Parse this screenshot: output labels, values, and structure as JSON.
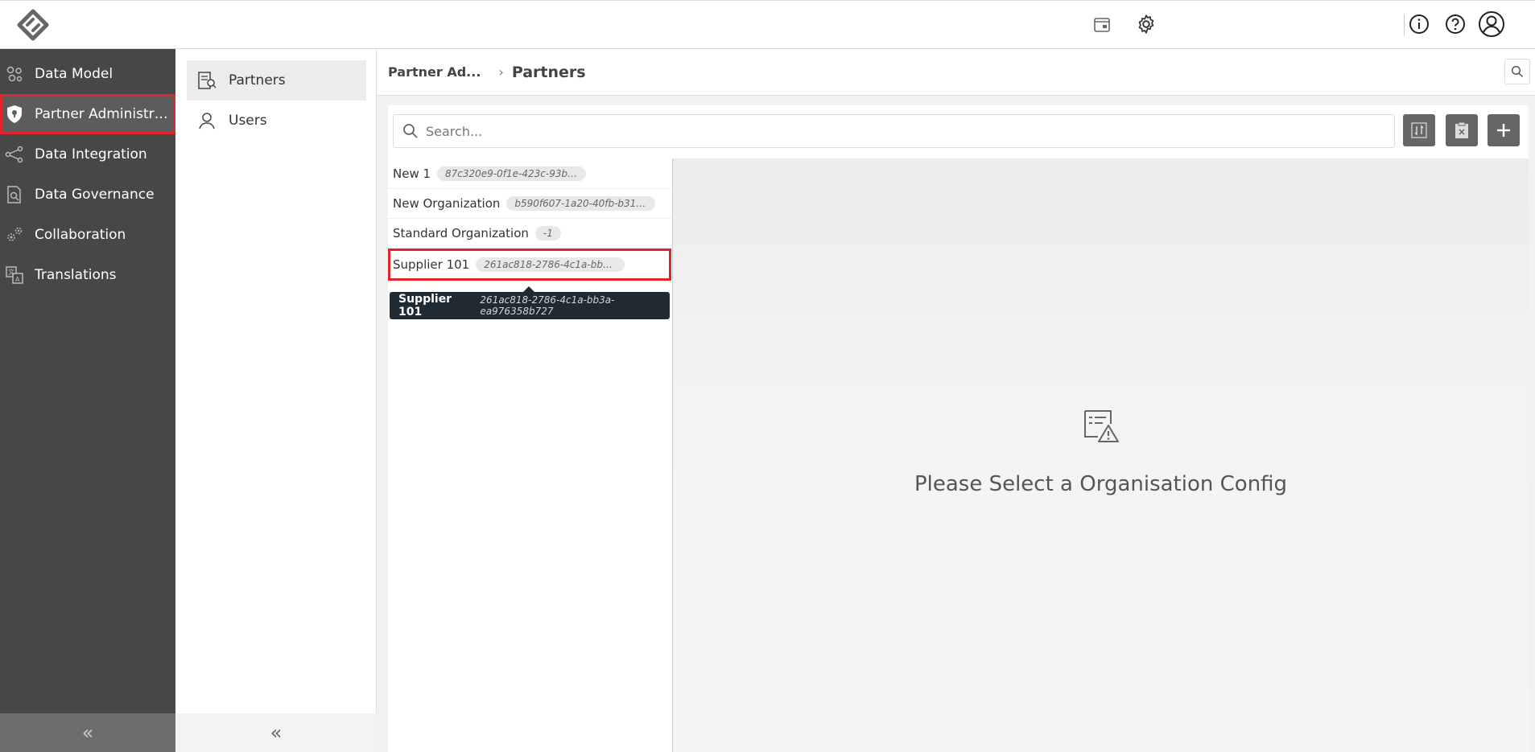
{
  "nav": {
    "items": [
      {
        "label": "Data Model",
        "icon": "data-model-icon"
      },
      {
        "label": "Partner Administrati...",
        "icon": "shield-icon"
      },
      {
        "label": "Data Integration",
        "icon": "share-nodes-icon"
      },
      {
        "label": "Data Governance",
        "icon": "document-search-icon"
      },
      {
        "label": "Collaboration",
        "icon": "gears-icon"
      },
      {
        "label": "Translations",
        "icon": "translate-icon"
      }
    ],
    "collapse_label": "«"
  },
  "subnav": {
    "items": [
      {
        "label": "Partners",
        "icon": "partners-icon"
      },
      {
        "label": "Users",
        "icon": "user-icon"
      }
    ],
    "collapse_label": "«"
  },
  "breadcrumb": {
    "parent": "Partner Ad...",
    "separator": "›",
    "current": "Partners"
  },
  "search": {
    "placeholder": "Search..."
  },
  "list": {
    "items": [
      {
        "name": "New 1",
        "id": "87c320e9-0f1e-423c-93b3-3fb61a14a45f"
      },
      {
        "name": "New Organization",
        "id": "b590f607-1a20-40fb-b315-7..."
      },
      {
        "name": "Standard Organization",
        "id": "-1"
      },
      {
        "name": "Supplier 101",
        "id": "261ac818-2786-4c1a-bb3a-ea9763..."
      }
    ]
  },
  "tooltip": {
    "name": "Supplier 101",
    "id": "261ac818-2786-4c1a-bb3a-ea976358b727"
  },
  "empty_state": {
    "message": "Please Select a Organisation Config"
  },
  "colors": {
    "nav_bg": "#474747",
    "highlight": "#e3242b",
    "tooltip_bg": "#1f2a33"
  }
}
